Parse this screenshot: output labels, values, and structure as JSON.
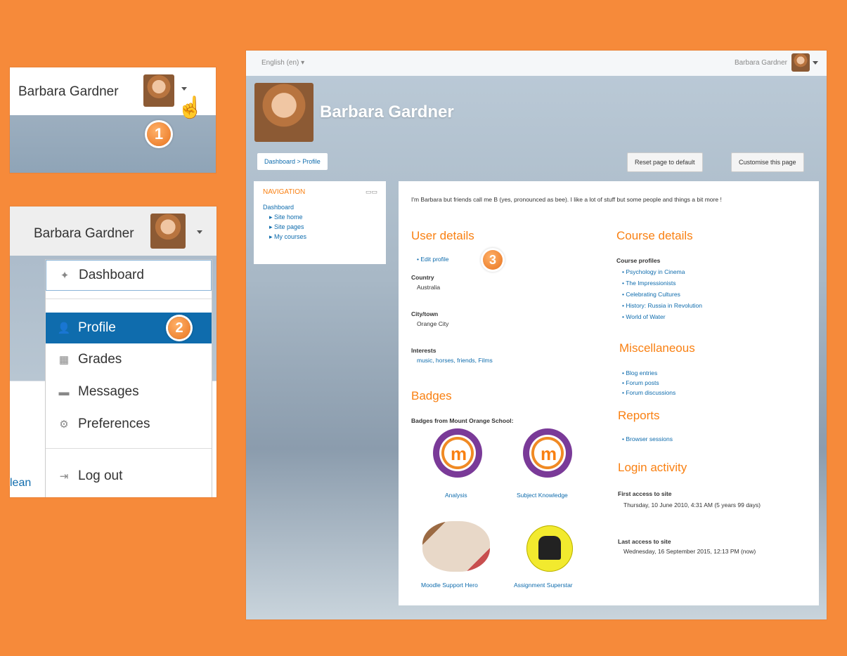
{
  "panel1": {
    "user_name": "Barbara Gardner",
    "step": "1"
  },
  "panel2": {
    "user_name": "Barbara Gardner",
    "step": "2",
    "menu": {
      "dashboard": "Dashboard",
      "profile": "Profile",
      "grades": "Grades",
      "messages": "Messages",
      "preferences": "Preferences",
      "logout": "Log out"
    },
    "side_link": "lean"
  },
  "profile_page": {
    "language": "English (en) ▾",
    "top_user": "Barbara Gardner",
    "heading": "Barbara Gardner",
    "breadcrumb": "Dashboard > Profile",
    "reset_button": "Reset page to default",
    "customise_button": "Customise this page",
    "navigation": {
      "title": "NAVIGATION",
      "items": [
        "Dashboard",
        "Site home",
        "Site pages",
        "My courses"
      ]
    },
    "bio": "I'm Barbara but friends call me B (yes, pronounced as bee). I like a lot of stuff but some people and things a bit more !",
    "step": "3",
    "user_details": {
      "title": "User details",
      "edit_profile": "Edit profile",
      "country_label": "Country",
      "country": "Australia",
      "city_label": "City/town",
      "city": "Orange City",
      "interests_label": "Interests",
      "interests": "music, horses, friends, Films"
    },
    "badges": {
      "title": "Badges",
      "from": "Badges from Mount Orange School:",
      "items": [
        "Analysis",
        "Subject Knowledge",
        "Moodle Support Hero",
        "Assignment Superstar"
      ]
    },
    "course_details": {
      "title": "Course details",
      "profiles_label": "Course profiles",
      "courses": [
        "Psychology in Cinema",
        "The Impressionists",
        "Celebrating Cultures",
        "History: Russia in Revolution",
        "World of Water"
      ]
    },
    "miscellaneous": {
      "title": "Miscellaneous",
      "items": [
        "Blog entries",
        "Forum posts",
        "Forum discussions"
      ]
    },
    "reports": {
      "title": "Reports",
      "items": [
        "Browser sessions"
      ]
    },
    "login_activity": {
      "title": "Login activity",
      "first_label": "First access to site",
      "first_value": "Thursday, 10 June 2010, 4:31 AM  (5 years 99 days)",
      "last_label": "Last access to site",
      "last_value": "Wednesday, 16 September 2015, 12:13 PM  (now)"
    }
  }
}
